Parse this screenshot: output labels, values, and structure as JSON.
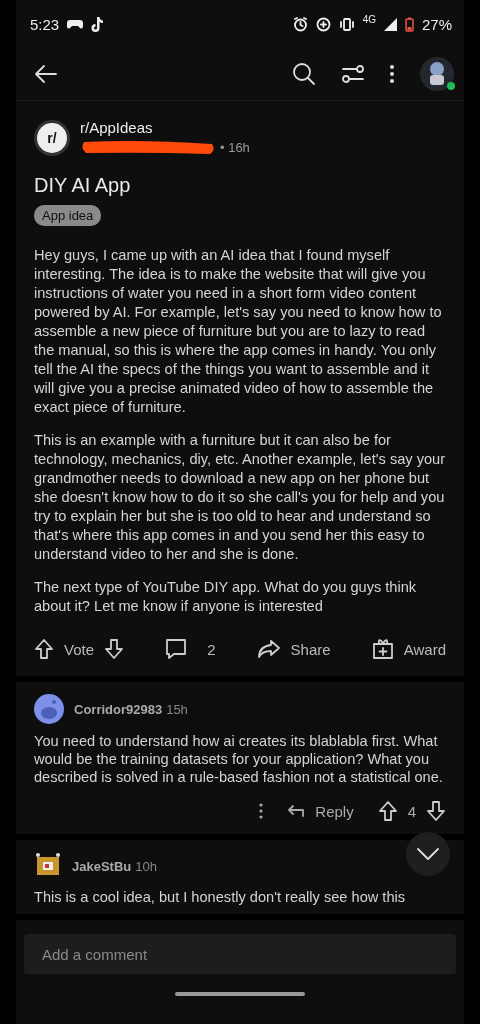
{
  "status_bar": {
    "time": "5:23",
    "network": "4G",
    "battery": "27%"
  },
  "post": {
    "subreddit": "r/AppIdeas",
    "subreddit_icon": "r/",
    "age": "• 16h",
    "title": "DIY AI App",
    "flair": "App idea",
    "paragraphs": [
      "Hey guys, I came up with an AI idea that I found myself interesting. The idea is to make the website that will give you instructions of water you need in a short form video content powered by AI. For example, let's say you need to know how to assemble a new piece of furniture but you are to lazy to read the manual, so this is where the app comes in handy. You only tell the AI the specs of the things you want to assemble and it will give you a precise animated video of how to assemble the exact piece of furniture.",
      "This is an example with a furniture but it can also be for technology, mechanics, diy, etc. Another example, let's say your grandmother needs to download a new app on her phone but she doesn't know how to do it so she call's you for help and you try to explain her but she is too old to hear and understand so that's where this app comes in and you send her this easy to understand video to her and she is done.",
      "The next type of YouTube DIY app. What do you guys think about it? Let me know if anyone is interested"
    ],
    "vote_label": "Vote",
    "comment_count": "2",
    "share_label": "Share",
    "award_label": "Award"
  },
  "comments": [
    {
      "kind": "full",
      "author": "Corridor92983",
      "age": "15h",
      "text": "You need to understand how ai creates its  blablabla first. What would be the training datasets for your application? What you described is solved in a rule-based fashion not a statistical one.",
      "reply_label": "Reply",
      "score": "4"
    },
    {
      "kind": "partial",
      "author": "JakeStBu",
      "age": "10h",
      "text": "This is a cool idea, but I honestly don't really see how this"
    }
  ],
  "comment_field": {
    "placeholder": "Add a comment"
  }
}
